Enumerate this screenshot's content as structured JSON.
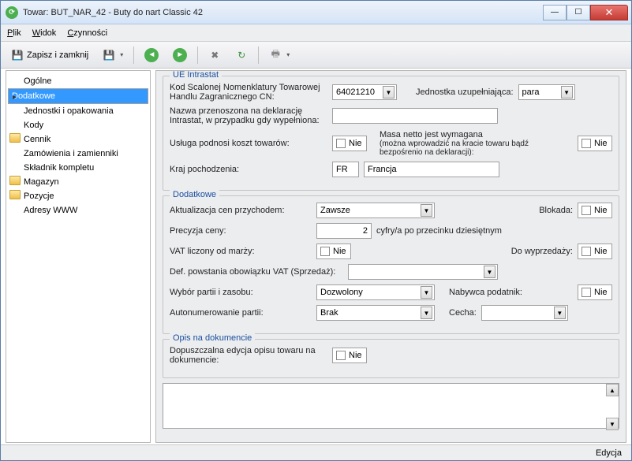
{
  "window": {
    "title": "Towar: BUT_NAR_42 - Buty do nart Classic 42"
  },
  "menu": {
    "file": "Plik",
    "view": "Widok",
    "actions": "Czynności"
  },
  "toolbar": {
    "save_close": "Zapisz i zamknij"
  },
  "nav": {
    "items": [
      {
        "label": "Ogólne",
        "folder": false,
        "sel": false
      },
      {
        "label": "Dodatkowe",
        "folder": false,
        "sel": true
      },
      {
        "label": "Jednostki i opakowania",
        "folder": false,
        "sel": false
      },
      {
        "label": "Kody",
        "folder": false,
        "sel": false
      },
      {
        "label": "Cennik",
        "folder": true,
        "sel": false
      },
      {
        "label": "Zamówienia i zamienniki",
        "folder": false,
        "sel": false
      },
      {
        "label": "Składnik kompletu",
        "folder": false,
        "sel": false
      },
      {
        "label": "Magazyn",
        "folder": true,
        "sel": false
      },
      {
        "label": "Pozycje",
        "folder": true,
        "sel": false
      },
      {
        "label": "Adresy WWW",
        "folder": false,
        "sel": false
      }
    ]
  },
  "grp1": {
    "title": "UE Intrastat",
    "cn_label": "Kod Scalonej Nomenklatury Towarowej Handlu Zagranicznego CN:",
    "cn_value": "64021210",
    "unit_label": "Jednostka uzupełniająca:",
    "unit_value": "para",
    "decl_label": "Nazwa przenoszona na deklarację Intrastat, w przypadku gdy wypełniona:",
    "srv_label": "Usługa podnosi koszt towarów:",
    "mass_label": "Masa netto jest wymagana",
    "mass_sub": "(można wprowadzić na kracie towaru bądź bezpośrenio na deklaracji):",
    "cc_label": "Kraj pochodzenia:",
    "cc_code": "FR",
    "cc_name": "Francja",
    "no": "Nie"
  },
  "grp2": {
    "title": "Dodatkowe",
    "upd_label": "Aktualizacja cen przychodem:",
    "upd_value": "Zawsze",
    "block_label": "Blokada:",
    "prec_label": "Precyzja ceny:",
    "prec_value": "2",
    "prec_suffix": "cyfry/a po przecinku dziesiętnym",
    "vat_label": "VAT liczony od marży:",
    "sale_label": "Do wyprzedaży:",
    "vatdef_label": "Def. powstania obowiązku VAT (Sprzedaż):",
    "batch_label": "Wybór partii i zasobu:",
    "batch_value": "Dozwolony",
    "taxpayer_label": "Nabywca podatnik:",
    "auto_label": "Autonumerowanie partii:",
    "auto_value": "Brak",
    "feat_label": "Cecha:",
    "no": "Nie"
  },
  "grp3": {
    "title": "Opis na dokumencie",
    "edit_label": "Dopuszczalna edycja opisu towaru na dokumencie:",
    "no": "Nie"
  },
  "status": "Edycja"
}
